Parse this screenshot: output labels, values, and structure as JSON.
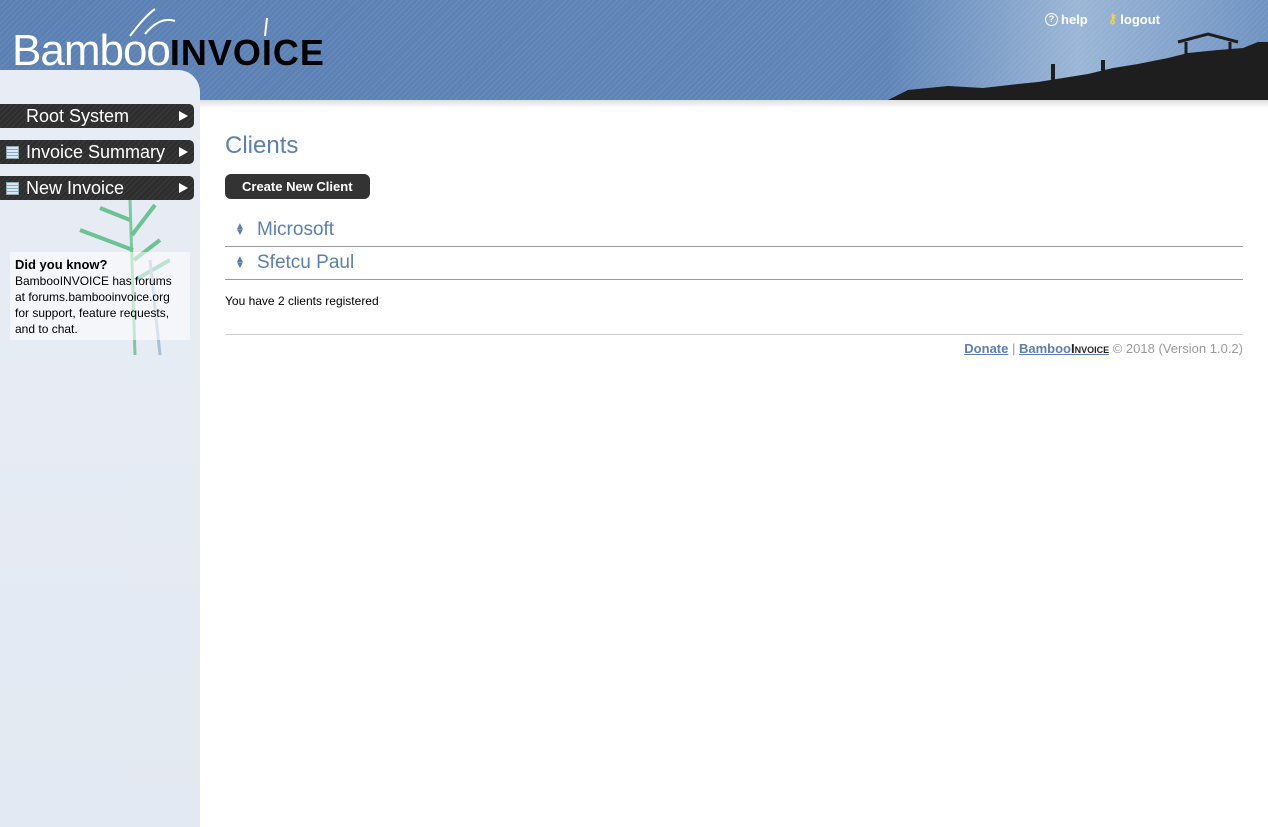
{
  "header": {
    "logo_text": "Bamboo",
    "logo_bold": "INVOICE",
    "help": "help",
    "logout": "logout"
  },
  "sidebar": {
    "items": [
      {
        "label": "Root System"
      },
      {
        "label": "Invoice Summary"
      },
      {
        "label": "New Invoice"
      }
    ],
    "tip_title": "Did you know?",
    "tip_body": "BambooINVOICE has forums at forums.bambooinvoice.org for support, feature requests, and to chat."
  },
  "main": {
    "title": "Clients",
    "create_button": "Create New Client",
    "clients": [
      "Microsoft",
      "Sfetcu Paul"
    ],
    "count_text": "You have 2 clients registered"
  },
  "footer": {
    "donate": "Donate",
    "brand": "Bamboo",
    "brand_small": "Invoice",
    "copyright": "© 2018 (Version 1.0.2)"
  }
}
